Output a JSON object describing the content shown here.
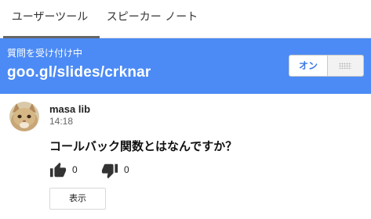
{
  "tabs": [
    {
      "label": "ユーザーツール",
      "active": true
    },
    {
      "label": "スピーカー ノート",
      "active": false
    }
  ],
  "banner": {
    "label": "質問を受け付け中",
    "url": "goo.gl/slides/crknar",
    "toggle_label": "オン",
    "background_color": "#4c8bf5"
  },
  "question": {
    "author": "masa lib",
    "time": "14:18",
    "text": "コールバック関数とはなんですか？",
    "thumbs_up_count": "0",
    "thumbs_down_count": "0",
    "show_button_label": "表示"
  },
  "icons": {
    "avatar": "cat-photo-avatar",
    "upvote": "thumbs-up-icon",
    "downvote": "thumbs-down-icon",
    "toggle_grip": "grip-dots-icon"
  }
}
